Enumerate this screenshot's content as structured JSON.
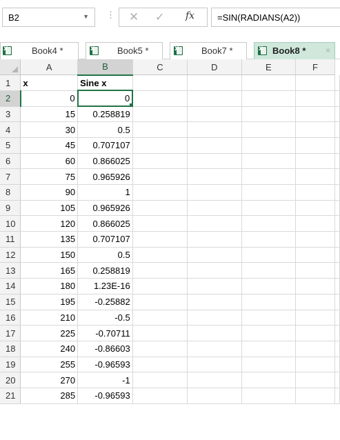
{
  "formula_bar": {
    "name_box": "B2",
    "name_box_arrow": "▼",
    "separator": "⋮",
    "cancel_icon": "✕",
    "enter_icon": "✓",
    "function_icon": "fx",
    "formula": "=SIN(RADIANS(A2))"
  },
  "tabs": [
    {
      "label": "Book4 *",
      "active": false
    },
    {
      "label": "Book5 *",
      "active": false
    },
    {
      "label": "Book7 *",
      "active": false
    },
    {
      "label": "Book8 *",
      "active": true,
      "close": "×"
    }
  ],
  "grid": {
    "columns": [
      "A",
      "B",
      "C",
      "D",
      "E",
      "F"
    ],
    "selected_column": "B",
    "selected_row": "2",
    "rows": [
      {
        "row": "1",
        "a": "x",
        "b": "Sine x"
      },
      {
        "row": "2",
        "a": "0",
        "b": "0"
      },
      {
        "row": "3",
        "a": "15",
        "b": "0.258819"
      },
      {
        "row": "4",
        "a": "30",
        "b": "0.5"
      },
      {
        "row": "5",
        "a": "45",
        "b": "0.707107"
      },
      {
        "row": "6",
        "a": "60",
        "b": "0.866025"
      },
      {
        "row": "7",
        "a": "75",
        "b": "0.965926"
      },
      {
        "row": "8",
        "a": "90",
        "b": "1"
      },
      {
        "row": "9",
        "a": "105",
        "b": "0.965926"
      },
      {
        "row": "10",
        "a": "120",
        "b": "0.866025"
      },
      {
        "row": "11",
        "a": "135",
        "b": "0.707107"
      },
      {
        "row": "12",
        "a": "150",
        "b": "0.5"
      },
      {
        "row": "13",
        "a": "165",
        "b": "0.258819"
      },
      {
        "row": "14",
        "a": "180",
        "b": "1.23E-16"
      },
      {
        "row": "15",
        "a": "195",
        "b": "-0.25882"
      },
      {
        "row": "16",
        "a": "210",
        "b": "-0.5"
      },
      {
        "row": "17",
        "a": "225",
        "b": "-0.70711"
      },
      {
        "row": "18",
        "a": "240",
        "b": "-0.86603"
      },
      {
        "row": "19",
        "a": "255",
        "b": "-0.96593"
      },
      {
        "row": "20",
        "a": "270",
        "b": "-1"
      },
      {
        "row": "21",
        "a": "285",
        "b": "-0.96593"
      }
    ]
  },
  "colors": {
    "accent": "#217346",
    "active_tab_bg": "#cfe8db",
    "header_bg": "#f3f3f3",
    "gridline": "#d9d9d9"
  }
}
